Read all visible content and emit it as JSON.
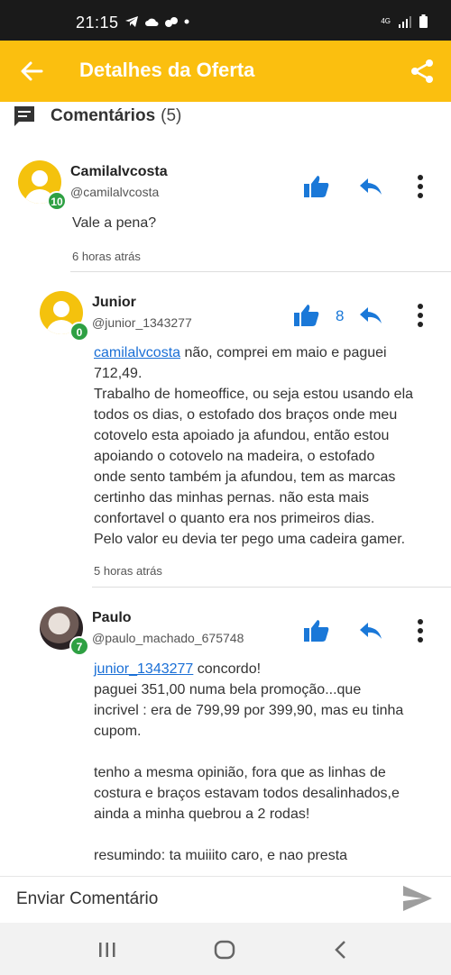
{
  "status": {
    "time": "21:15",
    "network": "4G"
  },
  "appbar": {
    "title": "Detalhes da Oferta"
  },
  "comments_header": {
    "title": "Comentários",
    "count": "(5)"
  },
  "comments": [
    {
      "name": "Camilalvcosta",
      "handle": "@camilalvcosta",
      "level": "10",
      "text": "Vale a pena?",
      "time": "6 horas atrás"
    },
    {
      "name": "Junior",
      "handle": "@junior_1343277",
      "level": "0",
      "likes": "8",
      "mention": "camilalvcosta",
      "text_lines": [
        " não, comprei em maio e paguei",
        "712,49.",
        "Trabalho de homeoffice, ou seja estou usando ela",
        "todos os dias, o estofado dos braços onde meu",
        "cotovelo esta apoiado ja afundou, então estou",
        "apoiando o cotovelo na madeira, o estofado",
        "onde sento também ja afundou, tem as marcas",
        "certinho das minhas pernas. não esta mais",
        "confortavel o quanto era nos primeiros dias.",
        "Pelo valor eu devia ter pego uma cadeira gamer."
      ],
      "time": "5 horas atrás"
    },
    {
      "name": "Paulo",
      "handle": "@paulo_machado_675748",
      "level": "7",
      "mention": "junior_1343277",
      "text_lines": [
        " concordo!",
        "paguei 351,00 numa bela promoção...que",
        "incrivel : era de 799,99 por 399,90, mas eu tinha",
        "cupom.",
        "",
        "tenho a mesma opinião, fora que as linhas de",
        "costura e braços estavam todos desalinhados,e",
        "ainda a minha quebrou a 2 rodas!",
        "",
        "resumindo: ta muiiito caro, e nao presta"
      ]
    }
  ],
  "composer": {
    "placeholder": "Enviar Comentário"
  },
  "colors": {
    "appbar": "#fbbf0f",
    "accent_blue": "#1a78d8",
    "level_badge": "#2ea043"
  },
  "icons": [
    "back-arrow-icon",
    "share-icon",
    "comment-icon",
    "thumbs-up-icon",
    "reply-icon",
    "more-vertical-icon",
    "send-icon"
  ]
}
